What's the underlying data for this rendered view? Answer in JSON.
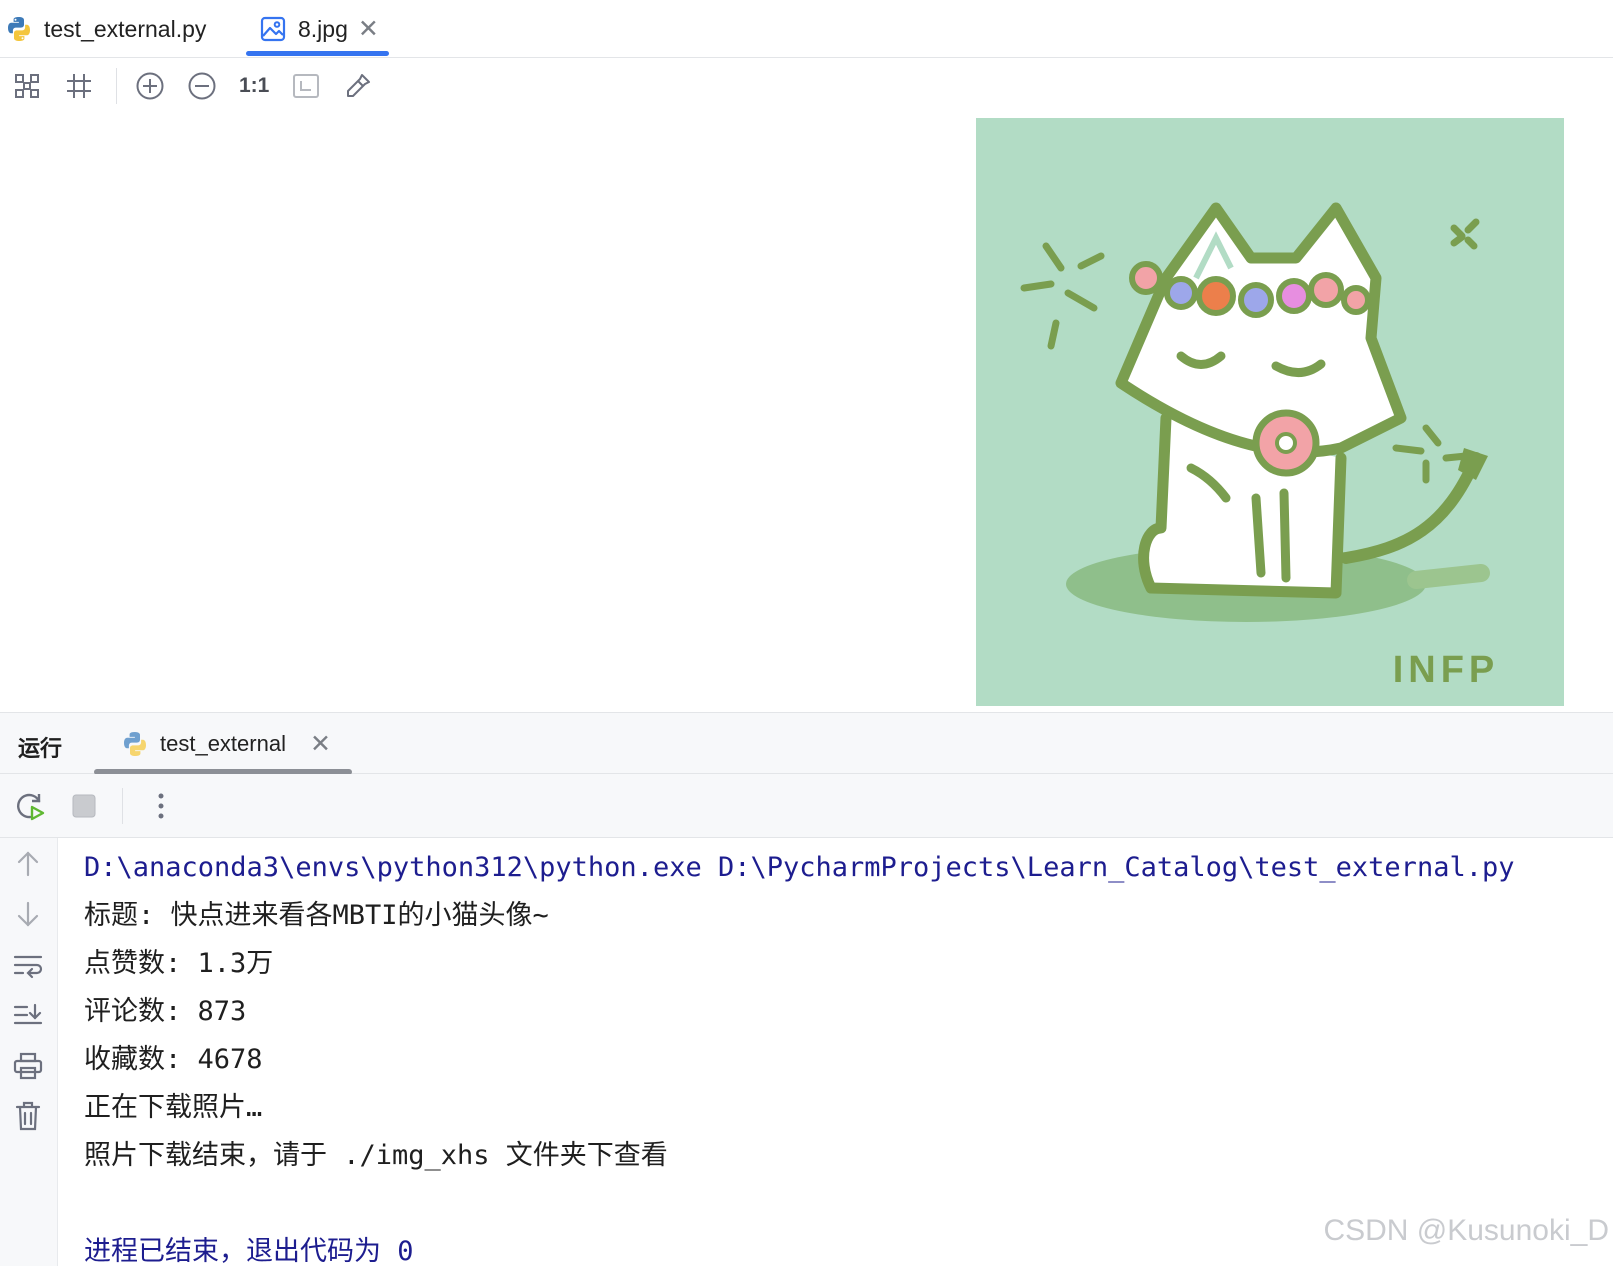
{
  "editor_tabs": [
    {
      "label": "test_external.py",
      "icon": "python-file-icon",
      "active": false
    },
    {
      "label": "8.jpg",
      "icon": "image-file-icon",
      "active": true,
      "close": "✕"
    }
  ],
  "viewer_toolbar": {
    "actual_size_label": "1:1",
    "buttons": [
      "fit-zoom-icon",
      "grid-icon",
      "zoom-in-icon",
      "zoom-out-icon",
      "actual-size",
      "fit-window-icon",
      "color-picker-icon"
    ]
  },
  "image": {
    "watermark_text": "INFP",
    "background_color": "#b2dcc5",
    "outline_color": "#7a9e4f"
  },
  "run_panel": {
    "title": "运行",
    "tab_label": "test_external",
    "tab_close": "✕",
    "console_lines": [
      {
        "text": "D:\\anaconda3\\envs\\python312\\python.exe D:\\PycharmProjects\\Learn_Catalog\\test_external.py",
        "kind": "sys"
      },
      {
        "text": "标题: 快点进来看各MBTI的小猫头像~",
        "kind": "out"
      },
      {
        "text": "点赞数: 1.3万",
        "kind": "out"
      },
      {
        "text": "评论数: 873",
        "kind": "out"
      },
      {
        "text": "收藏数: 4678",
        "kind": "out"
      },
      {
        "text": "正在下载照片…",
        "kind": "out"
      },
      {
        "text": "照片下载结束，请于 ./img_xhs 文件夹下查看",
        "kind": "out"
      },
      {
        "text": "",
        "kind": "out"
      },
      {
        "text": "进程已结束，退出代码为 0",
        "kind": "sys"
      }
    ]
  },
  "watermark": "CSDN @Kusunoki_D",
  "colors": {
    "accent": "#3574f0",
    "console_system": "#1d1d8f",
    "run_green": "#5fb832"
  }
}
